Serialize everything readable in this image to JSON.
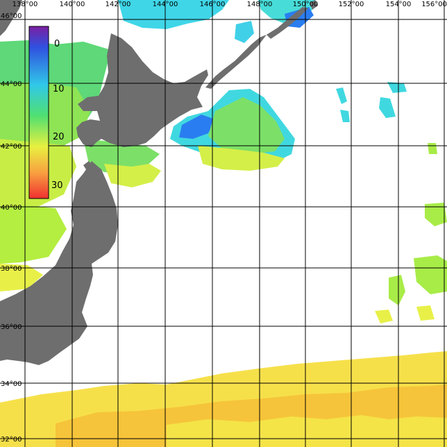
{
  "map": {
    "longitude_labels": [
      "138°00",
      "140°00",
      "142°00",
      "144°00",
      "146°00",
      "148°00",
      "150°00",
      "152°00",
      "154°00",
      "156°00"
    ],
    "latitude_labels": [
      "46°00",
      "44°00",
      "42°00",
      "40°00",
      "38°00",
      "36°00",
      "34°00",
      "32°00"
    ],
    "colorbar": {
      "tick_labels": [
        "0",
        "10",
        "20",
        "30"
      ],
      "colors": [
        "#7a1fa2",
        "#3050e0",
        "#30c8e8",
        "#50e070",
        "#e8f040",
        "#f8a040",
        "#f03030"
      ]
    },
    "colors": {
      "land": "#6e6e6e",
      "grid": "#000000",
      "sst_cold": "#2a7df0",
      "sst_cool": "#40d8e0",
      "sst_mid": "#70e060",
      "sst_mild": "#b4ee40",
      "sst_warm": "#f4e448",
      "sst_hot": "#f6c43a"
    }
  }
}
